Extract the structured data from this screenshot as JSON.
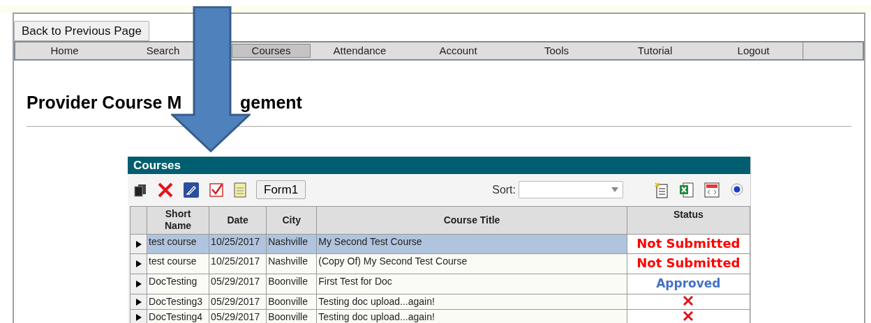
{
  "back_button": "Back to Previous Page",
  "nav": [
    {
      "label": "Home",
      "selected": false
    },
    {
      "label": "Search",
      "selected": false
    },
    {
      "label": "Courses",
      "selected": true
    },
    {
      "label": "Attendance",
      "selected": false
    },
    {
      "label": "Account",
      "selected": false
    },
    {
      "label": "Tools",
      "selected": false
    },
    {
      "label": "Tutorial",
      "selected": false
    },
    {
      "label": "Logout",
      "selected": false
    }
  ],
  "heading_parts": [
    "Provider Course M",
    "gement"
  ],
  "panel": {
    "title": "Courses",
    "form_button": "Form1",
    "sort_label": "Sort:",
    "columns": [
      "Short\nName",
      "Date",
      "City",
      "Course Title",
      "Status"
    ],
    "rows": [
      {
        "selected": true,
        "short_name": "test course",
        "date": "10/25/2017",
        "city": "Nashville",
        "title": "My Second Test Course",
        "status": {
          "kind": "not_submitted",
          "text": "Not Submitted"
        }
      },
      {
        "selected": false,
        "short_name": "test course",
        "date": "10/25/2017",
        "city": "Nashville",
        "title": "(Copy Of) My Second Test Course",
        "status": {
          "kind": "not_submitted",
          "text": "Not Submitted"
        }
      },
      {
        "selected": false,
        "short_name": "DocTesting",
        "date": "05/29/2017",
        "city": "Boonville",
        "title": "First Test for Doc",
        "status": {
          "kind": "approved",
          "text": "Approved"
        }
      },
      {
        "selected": false,
        "short_name": "DocTesting3",
        "date": "05/29/2017",
        "city": "Boonville",
        "title": "Testing doc upload...again!",
        "status": {
          "kind": "cross"
        }
      },
      {
        "selected": false,
        "short_name": "DocTesting4",
        "date": "05/29/2017",
        "city": "Boonville",
        "title": "Testing doc upload...again!",
        "status": {
          "kind": "cross"
        }
      }
    ]
  }
}
